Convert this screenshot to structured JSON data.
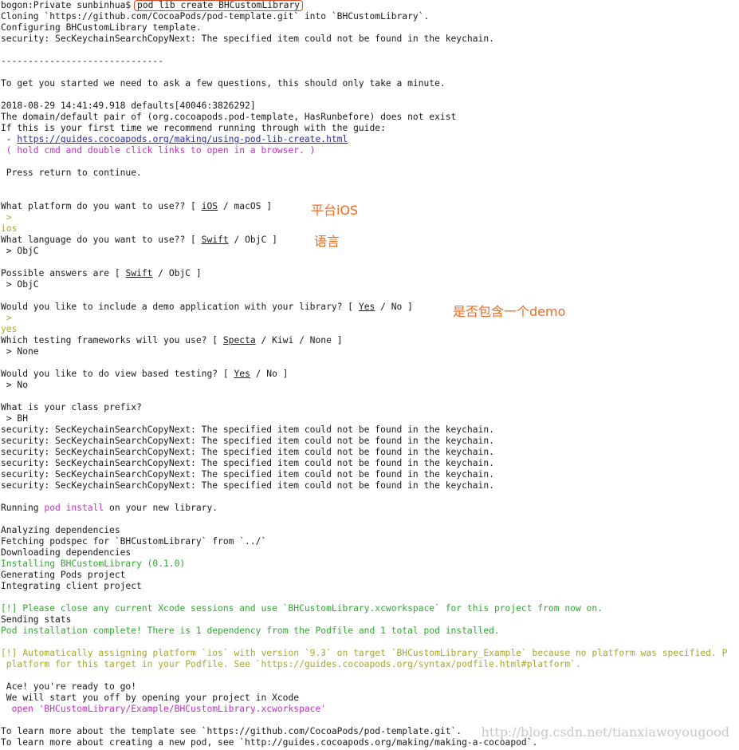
{
  "terminal": {
    "prompt": "bogon:Private sunbinhua$ ",
    "command": "pod lib create BHCustomLibrary",
    "cloning": "Cloning `https://github.com/CocoaPods/pod-template.git` into `BHCustomLibrary`.",
    "configuring": "Configuring BHCustomLibrary template.",
    "keychain_msg": "security: SecKeychainSearchCopyNext: The specified item could not be found in the keychain.",
    "separator": "------------------------------",
    "intro": "To get you started we need to ask a few questions, this should only take a minute.",
    "defaults_log": "2018-08-29 14:41:49.918 defaults[40046:3826292]",
    "domain_msg": "The domain/default pair of (org.cocoapods.pod-template, HasRunbefore) does not exist",
    "first_time_msg": "If this is your first time we recommend running through with the guide:",
    "guide_bullet": " - ",
    "guide_url": "https://guides.cocoapods.org/making/using-pod-lib-create.html",
    "hold_cmd": " ( hold cmd and double click links to open in a browser. )",
    "press_return": " Press return to continue.",
    "answer_prompt": " > ",
    "q_platform_pre": "What platform do you want to use?? [ ",
    "q_platform_default": "iOS",
    "q_platform_post": " / macOS ]",
    "a_platform": "ios",
    "q_language_pre": "What language do you want to use?? [ ",
    "q_language_default": "Swift",
    "q_language_post": " / ObjC ]",
    "a_language": " > ObjC",
    "possible_pre": "Possible answers are [ ",
    "possible_default": "Swift",
    "possible_post": " / ObjC ]",
    "a_language2": " > ObjC",
    "q_demo_pre": "Would you like to include a demo application with your library? [ ",
    "q_demo_default": "Yes",
    "q_demo_post": " / No ]",
    "a_demo": "yes",
    "q_testing_pre": "Which testing frameworks will you use? [ ",
    "q_testing_default": "Specta",
    "q_testing_post": " / Kiwi / None ]",
    "a_testing": " > None",
    "q_view_pre": "Would you like to do view based testing? [ ",
    "q_view_default": "Yes",
    "q_view_post": " / No ]",
    "a_view": " > No",
    "q_prefix": "What is your class prefix?",
    "a_prefix": " > BH",
    "running_pre": "Running ",
    "running_cmd": "pod install",
    "running_post": " on your new library.",
    "analyzing": "Analyzing dependencies",
    "fetching": "Fetching podspec for `BHCustomLibrary` from `../`",
    "downloading": "Downloading dependencies",
    "installing": "Installing BHCustomLibrary (0.1.0)",
    "generating": "Generating Pods project",
    "integrating": "Integrating client project",
    "close_xcode": "[!] Please close any current Xcode sessions and use `BHCustomLibrary.xcworkspace` for this project from now on.",
    "sending_stats": "Sending stats",
    "install_complete": "Pod installation complete! There is 1 dependency from the Podfile and 1 total pod installed.",
    "platform_warn_1": "[!] Automatically assigning platform `ios` with version `9.3` on target `BHCustomLibrary_Example` because no platform was specified. P",
    "platform_warn_2": " platform for this target in your Podfile. See `https://guides.cocoapods.org/syntax/podfile.html#platform`.",
    "ace": " Ace! you're ready to go!",
    "start_off": " We will start you off by opening your project in Xcode",
    "open_cmd": "  open 'BHCustomLibrary/Example/BHCustomLibrary.xcworkspace'",
    "learn_template": "To learn more about the template see `https://github.com/CocoaPods/pod-template.git`.",
    "learn_pod": "To learn more about creating a new pod, see `http://guides.cocoapods.org/making/making-a-cocoapod`."
  },
  "annotations": {
    "platform": "平台iOS",
    "language": "语言",
    "demo": "是否包含一个demo"
  },
  "watermark": "http://blog.csdn.net/tianxiawoyougood",
  "colors": {
    "highlight_border": "#e2461b",
    "annotation": "#ef6a1d",
    "green": "#2fa92f",
    "magenta": "#c22fc2",
    "olive": "#a7a82a",
    "link": "#2a2aaa"
  }
}
